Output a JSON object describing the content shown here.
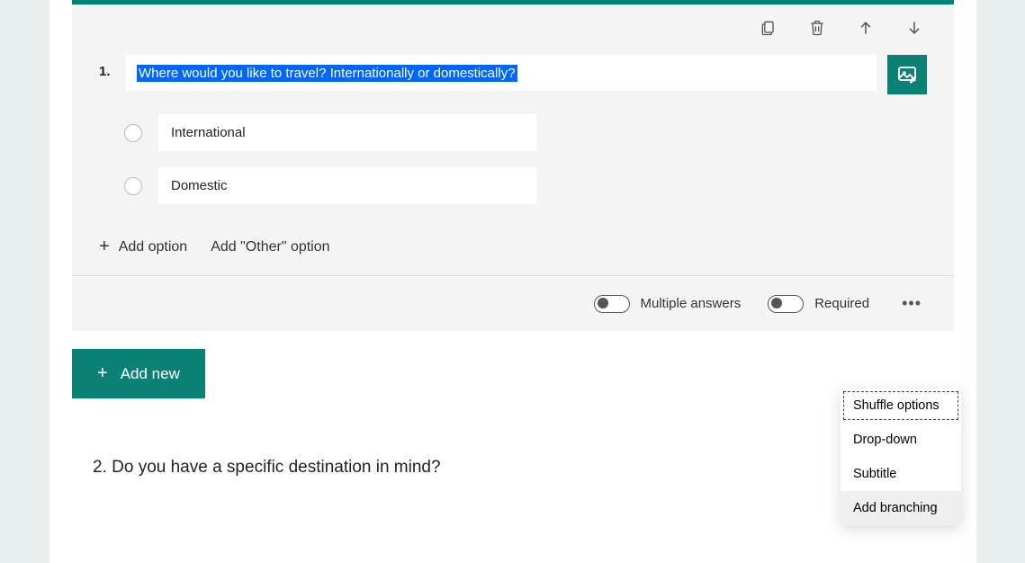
{
  "question1": {
    "number": "1.",
    "text": "Where would you like to travel? Internationally or domestically?",
    "options": [
      "International",
      "Domestic"
    ],
    "add_option_label": "Add option",
    "add_other_label": "Add \"Other\" option"
  },
  "footer": {
    "multiple_label": "Multiple answers",
    "required_label": "Required"
  },
  "add_new_label": "Add new",
  "question2_text": "2. Do you have a specific destination in mind?",
  "dropdown": {
    "items": [
      "Shuffle options",
      "Drop-down",
      "Subtitle",
      "Add branching"
    ]
  },
  "colors": {
    "brand": "#0b8074",
    "selection": "#0066ff"
  }
}
